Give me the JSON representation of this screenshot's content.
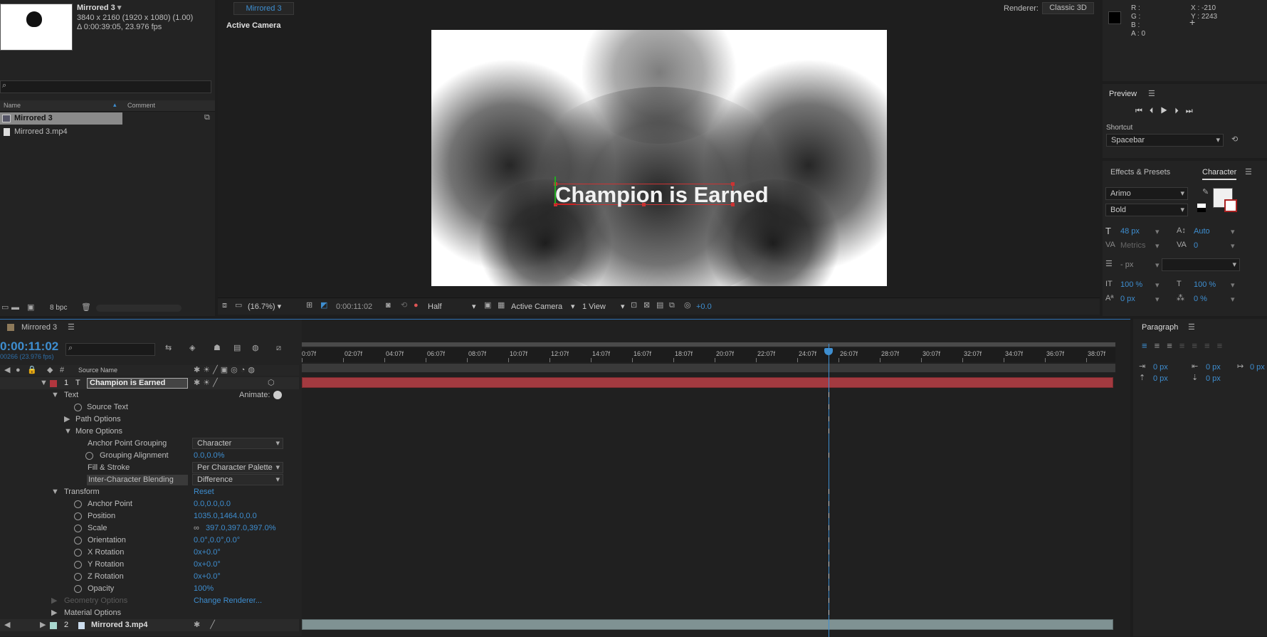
{
  "project": {
    "comp_name": "Mirrored 3",
    "comp_dims": "3840 x 2160  (1920 x 1080) (1.00)",
    "comp_duration": "Δ 0:00:39:05, 23.976 fps",
    "col_name": "Name",
    "col_comment": "Comment",
    "items": [
      {
        "label": "Mirrored 3",
        "selected": true
      },
      {
        "label": "Mirrored 3.mp4",
        "selected": false
      }
    ],
    "bpc": "8 bpc"
  },
  "comp": {
    "tab": "Mirrored 3",
    "renderer_label": "Renderer:",
    "renderer_value": "Classic 3D",
    "view_label": "Active Camera",
    "text_overlay": "Champion is Earned",
    "zoom": "(16.7%)",
    "timecode": "0:00:11:02",
    "resolution": "Half",
    "camera": "Active Camera",
    "views": "1 View",
    "exposure": "+0.0"
  },
  "info": {
    "r": "R :",
    "g": "G :",
    "b": "B :",
    "a": "A : 0",
    "x": "X : -210",
    "y": "Y : 2243"
  },
  "preview": {
    "title": "Preview",
    "shortcut_label": "Shortcut",
    "shortcut_value": "Spacebar"
  },
  "character": {
    "tab_effects": "Effects & Presets",
    "tab_character": "Character",
    "font": "Arimo",
    "style": "Bold",
    "size": "48 px",
    "leading": "Auto",
    "kerning": "Metrics",
    "tracking": "0",
    "stroke": "- px",
    "vscale": "100 %",
    "hscale": "100 %",
    "baseline": "0 px",
    "tsume": "0 %"
  },
  "timeline": {
    "tab": "Mirrored 3",
    "timecode": "0:00:11:02",
    "frames": "00266 (23.976 fps)",
    "source_col": "Source Name",
    "ruler": [
      "0:07f",
      "02:07f",
      "04:07f",
      "06:07f",
      "08:07f",
      "10:07f",
      "12:07f",
      "14:07f",
      "16:07f",
      "18:07f",
      "20:07f",
      "22:07f",
      "24:07f",
      "26:07f",
      "28:07f",
      "30:07f",
      "32:07f",
      "34:07f",
      "36:07f",
      "38:07f"
    ],
    "layer1": {
      "num": "1",
      "name": "Champion is Earned"
    },
    "layer2": {
      "num": "2",
      "name": "Mirrored 3.mp4"
    },
    "props": {
      "text": "Text",
      "animate": "Animate:",
      "source_text": "Source Text",
      "path_options": "Path Options",
      "more_options": "More Options",
      "apg": "Anchor Point Grouping",
      "apg_val": "Character",
      "ga": "Grouping Alignment",
      "ga_val": "0.0,0.0%",
      "fs": "Fill & Stroke",
      "fs_val": "Per Character Palette",
      "icb": "Inter-Character Blending",
      "icb_val": "Difference",
      "transform": "Transform",
      "reset": "Reset",
      "anchor": "Anchor Point",
      "anchor_val": "0.0,0.0,0.0",
      "position": "Position",
      "position_val": "1035.0,1464.0,0.0",
      "scale": "Scale",
      "scale_val": "397.0,397.0,397.0%",
      "orientation": "Orientation",
      "orientation_val": "0.0°,0.0°,0.0°",
      "xrot": "X Rotation",
      "xrot_val": "0x+0.0°",
      "yrot": "Y Rotation",
      "yrot_val": "0x+0.0°",
      "zrot": "Z Rotation",
      "zrot_val": "0x+0.0°",
      "opacity": "Opacity",
      "opacity_val": "100%",
      "geometry": "Geometry Options",
      "change_renderer": "Change Renderer...",
      "material": "Material Options"
    }
  },
  "paragraph": {
    "title": "Paragraph",
    "indent_left": "0 px",
    "indent_right": "0 px",
    "indent_first": "0 px",
    "space_before": "0 px",
    "space_after": "0 px"
  },
  "colors": {
    "accent": "#3e8ed0",
    "text_layer": "#b0363e",
    "video_layer": "#7f9293"
  }
}
